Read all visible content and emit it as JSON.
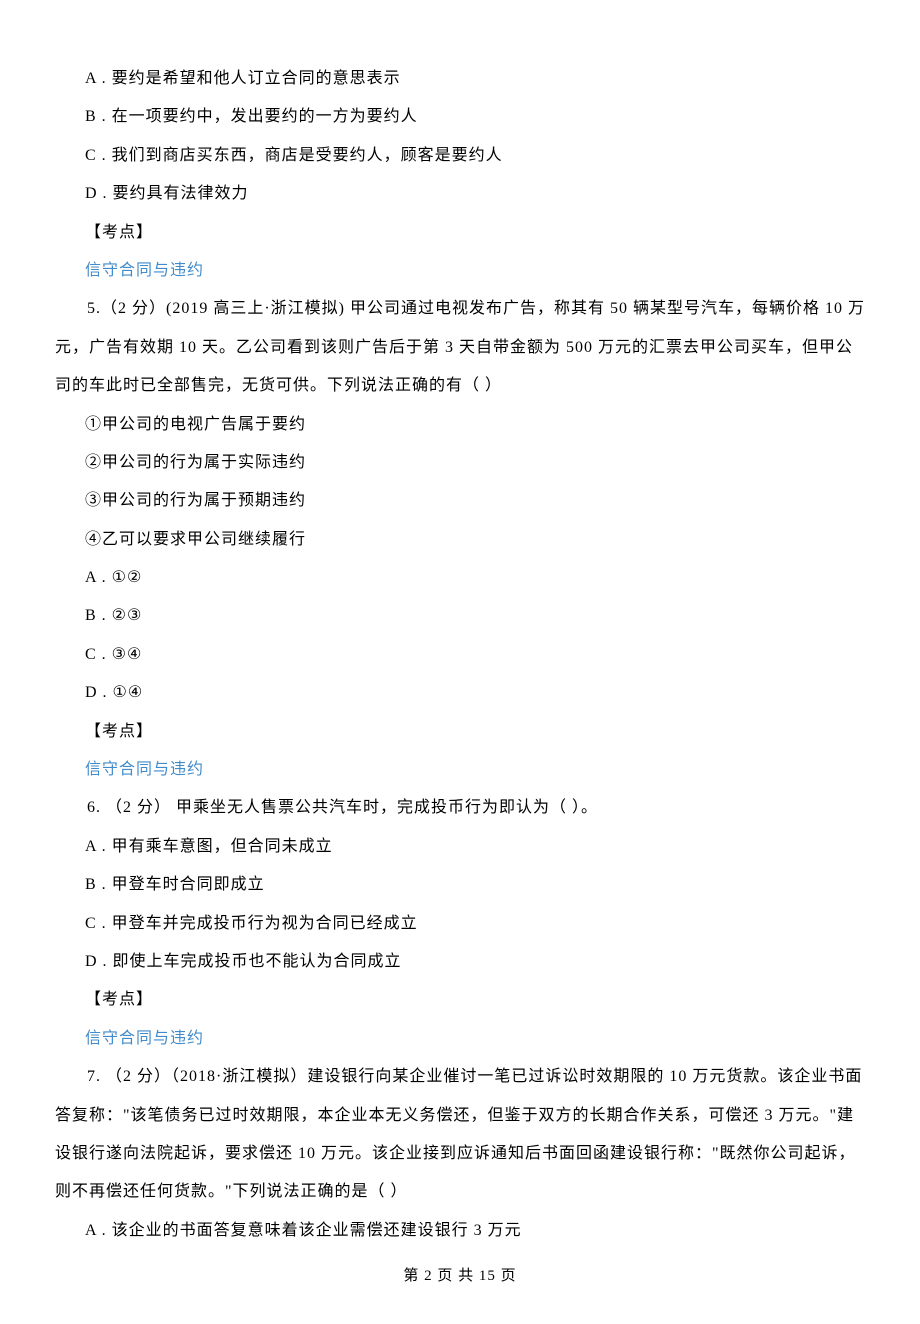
{
  "q4": {
    "optA": "A . 要约是希望和他人订立合同的意思表示",
    "optB": "B . 在一项要约中，发出要约的一方为要约人",
    "optC": "C . 我们到商店买东西，商店是受要约人，顾客是要约人",
    "optD": "D . 要约具有法律效力",
    "kaodian": "【考点】",
    "topic": "信守合同与违约"
  },
  "q5": {
    "text": "5.（2 分）(2019 高三上·浙江模拟) 甲公司通过电视发布广告，称其有 50 辆某型号汽车，每辆价格 10 万元，广告有效期 10 天。乙公司看到该则广告后于第 3 天自带金额为 500 万元的汇票去甲公司买车，但甲公司的车此时已全部售完，无货可供。下列说法正确的有（    ）",
    "s1": "①甲公司的电视广告属于要约",
    "s2": "②甲公司的行为属于实际违约",
    "s3": "③甲公司的行为属于预期违约",
    "s4": "④乙可以要求甲公司继续履行",
    "optA": "A . ①②",
    "optB": "B . ②③",
    "optC": "C . ③④",
    "optD": "D . ①④",
    "kaodian": "【考点】",
    "topic": "信守合同与违约"
  },
  "q6": {
    "text": "6. （2 分）  甲乘坐无人售票公共汽车时，完成投币行为即认为（    ）。",
    "optA": "A . 甲有乘车意图，但合同未成立",
    "optB": "B . 甲登车时合同即成立",
    "optC": "C . 甲登车并完成投币行为视为合同已经成立",
    "optD": "D . 即使上车完成投币也不能认为合同成立",
    "kaodian": "【考点】",
    "topic": "信守合同与违约"
  },
  "q7": {
    "text": "7. （2 分）（2018·浙江模拟）建设银行向某企业催讨一笔已过诉讼时效期限的 10 万元货款。该企业书面答复称：\"该笔债务已过时效期限，本企业本无义务偿还，但鉴于双方的长期合作关系，可偿还 3 万元。\"建设银行遂向法院起诉，要求偿还 10 万元。该企业接到应诉通知后书面回函建设银行称：\"既然你公司起诉，则不再偿还任何货款。\"下列说法正确的是（    ）",
    "optA": "A . 该企业的书面答复意味着该企业需偿还建设银行 3 万元"
  },
  "footer": "第 2 页 共 15 页"
}
